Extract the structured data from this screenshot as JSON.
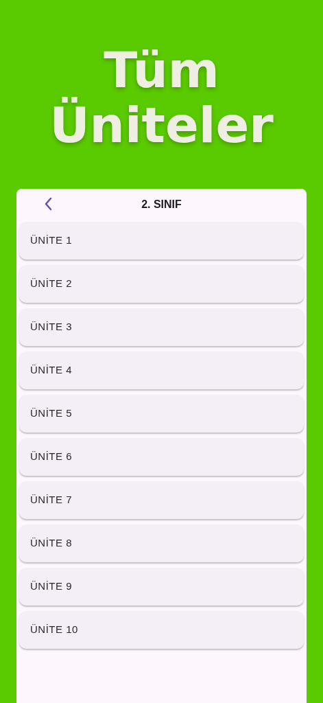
{
  "title": "Tüm Üniteler",
  "panel": {
    "header": {
      "title": "2. SINIF"
    },
    "units": [
      {
        "label": "ÜNİTE 1"
      },
      {
        "label": "ÜNİTE 2"
      },
      {
        "label": "ÜNİTE 3"
      },
      {
        "label": "ÜNİTE 4"
      },
      {
        "label": "ÜNİTE 5"
      },
      {
        "label": "ÜNİTE 6"
      },
      {
        "label": "ÜNİTE 7"
      },
      {
        "label": "ÜNİTE 8"
      },
      {
        "label": "ÜNİTE 9"
      },
      {
        "label": "ÜNİTE 10"
      }
    ]
  }
}
